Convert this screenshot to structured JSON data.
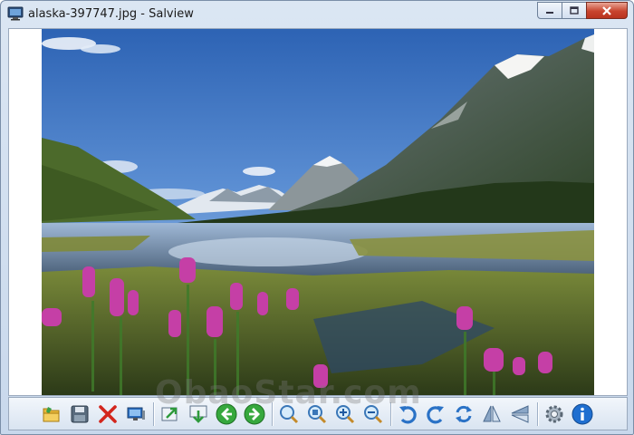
{
  "window": {
    "title": "alaska-397747.jpg - Salview",
    "icon": "monitor-icon",
    "controls": [
      "minimize",
      "maximize",
      "close"
    ]
  },
  "image": {
    "description_icon": "landscape-photo"
  },
  "toolbar": {
    "buttons": [
      {
        "name": "open-folder-button",
        "icon": "folder-icon"
      },
      {
        "name": "save-button",
        "icon": "floppy-icon"
      },
      {
        "name": "delete-button",
        "icon": "x-icon"
      },
      {
        "name": "slideshow-button",
        "icon": "monitor-icon"
      },
      {
        "name": "export-button",
        "icon": "export-icon"
      },
      {
        "name": "import-button",
        "icon": "import-icon"
      },
      {
        "name": "previous-button",
        "icon": "arrow-left-icon"
      },
      {
        "name": "next-button",
        "icon": "arrow-right-icon"
      },
      {
        "name": "zoom-fit-button",
        "icon": "magnifier-icon"
      },
      {
        "name": "zoom-actual-button",
        "icon": "magnifier-icon"
      },
      {
        "name": "zoom-in-button",
        "icon": "zoom-in-icon"
      },
      {
        "name": "zoom-out-button",
        "icon": "zoom-out-icon"
      },
      {
        "name": "rotate-left-button",
        "icon": "rotate-left-icon"
      },
      {
        "name": "rotate-right-button",
        "icon": "rotate-right-icon"
      },
      {
        "name": "refresh-button",
        "icon": "refresh-icon"
      },
      {
        "name": "flip-vertical-button",
        "icon": "flip-vertical-icon"
      },
      {
        "name": "flip-horizontal-button",
        "icon": "flip-horizontal-icon"
      },
      {
        "name": "settings-button",
        "icon": "gear-icon"
      },
      {
        "name": "info-button",
        "icon": "info-icon"
      }
    ]
  },
  "watermark": {
    "text": "ObaoStar.com"
  }
}
